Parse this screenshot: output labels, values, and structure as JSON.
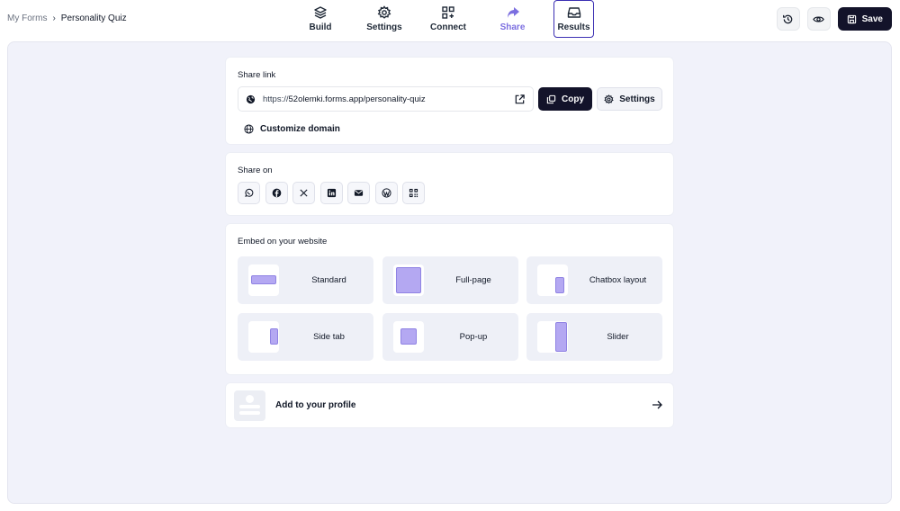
{
  "breadcrumb": {
    "parent": "My Forms",
    "separator": "›",
    "current": "Personality Quiz"
  },
  "nav": {
    "tabs": [
      {
        "label": "Build",
        "icon": "layers-icon"
      },
      {
        "label": "Settings",
        "icon": "gear-icon"
      },
      {
        "label": "Connect",
        "icon": "connect-grid-icon"
      },
      {
        "label": "Share",
        "icon": "share-arrow-icon",
        "active": true
      },
      {
        "label": "Results",
        "icon": "inbox-icon",
        "selected": true
      }
    ]
  },
  "toolbar": {
    "history_icon": "history-icon",
    "preview_icon": "eye-icon",
    "save_label": "Save"
  },
  "share_link": {
    "title": "Share link",
    "url_prefix": "https://",
    "url_rest": "52olemki.forms.app/personality-quiz",
    "copy_label": "Copy",
    "settings_label": "Settings",
    "customize_domain_label": "Customize domain"
  },
  "share_on": {
    "title": "Share on",
    "icons": [
      "whatsapp-icon",
      "facebook-icon",
      "x-icon",
      "linkedin-icon",
      "email-icon",
      "wordpress-icon",
      "qr-code-icon"
    ]
  },
  "embed": {
    "title": "Embed on your website",
    "options": [
      {
        "label": "Standard"
      },
      {
        "label": "Full-page"
      },
      {
        "label": "Chatbox layout"
      },
      {
        "label": "Side tab"
      },
      {
        "label": "Pop-up"
      },
      {
        "label": "Slider"
      }
    ]
  },
  "profile": {
    "label": "Add to your profile"
  },
  "colors": {
    "accent": "#7c6fe0",
    "dark": "#13132a",
    "canvas": "#f1f2fa",
    "thumb_purple": "#b4a8f2"
  }
}
